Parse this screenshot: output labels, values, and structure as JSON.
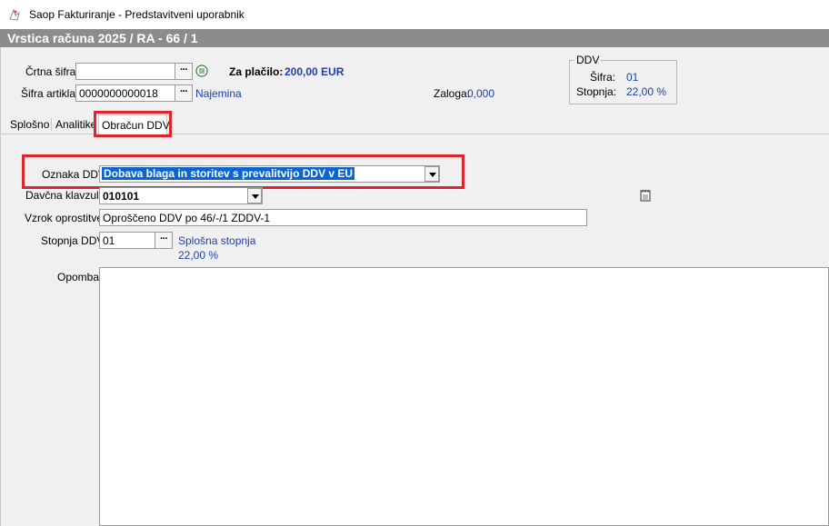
{
  "window": {
    "title": "Saop Fakturiranje - Predstavitveni uporabnik"
  },
  "header": {
    "title": "Vrstica računa  2025 / RA - 66 / 1"
  },
  "top": {
    "crtna_sifra_label": "Črtna šifra",
    "crtna_sifra_value": "",
    "sifra_artikla_label": "Šifra artikla",
    "sifra_artikla_value": "0000000000018",
    "artikel_name": "Najemina",
    "za_placilo_label": "Za plačilo:",
    "za_placilo_value": "200,00 EUR",
    "zaloga_label": "Zaloga:",
    "zaloga_value": "0,000",
    "ellipsis": "···"
  },
  "ddv_group": {
    "title": "DDV",
    "sifra_label": "Šifra:",
    "sifra_value": "01",
    "stopnja_label": "Stopnja:",
    "stopnja_value": "22,00 %"
  },
  "tabs": [
    {
      "label": "Splošno",
      "active": false
    },
    {
      "label": "Analitike",
      "active": false
    },
    {
      "label": "Obračun DDV",
      "active": true
    }
  ],
  "form": {
    "oznaka_ddv_label": "Oznaka DDV",
    "oznaka_ddv_value": "Dobava blaga in storitev s prevalitvijo DDV v EU",
    "davcna_klavzula_label": "Davčna klavzula",
    "davcna_klavzula_value": "010101",
    "vzrok_label": "Vzrok oprostitve",
    "vzrok_value": "Oproščeno DDV po 46/-/1 ZDDV-1",
    "stopnja_ddv_label": "Stopnja DDV",
    "stopnja_ddv_value": "01",
    "stopnja_name": "Splošna stopnja",
    "stopnja_percent": "22,00 %",
    "opomba_label": "Opomba",
    "opomba_value": ""
  },
  "colors": {
    "highlight": "#e0242e",
    "selection": "#0a64d2",
    "link_blue": "#1f3fb0",
    "header_gray": "#8c8c8c"
  }
}
